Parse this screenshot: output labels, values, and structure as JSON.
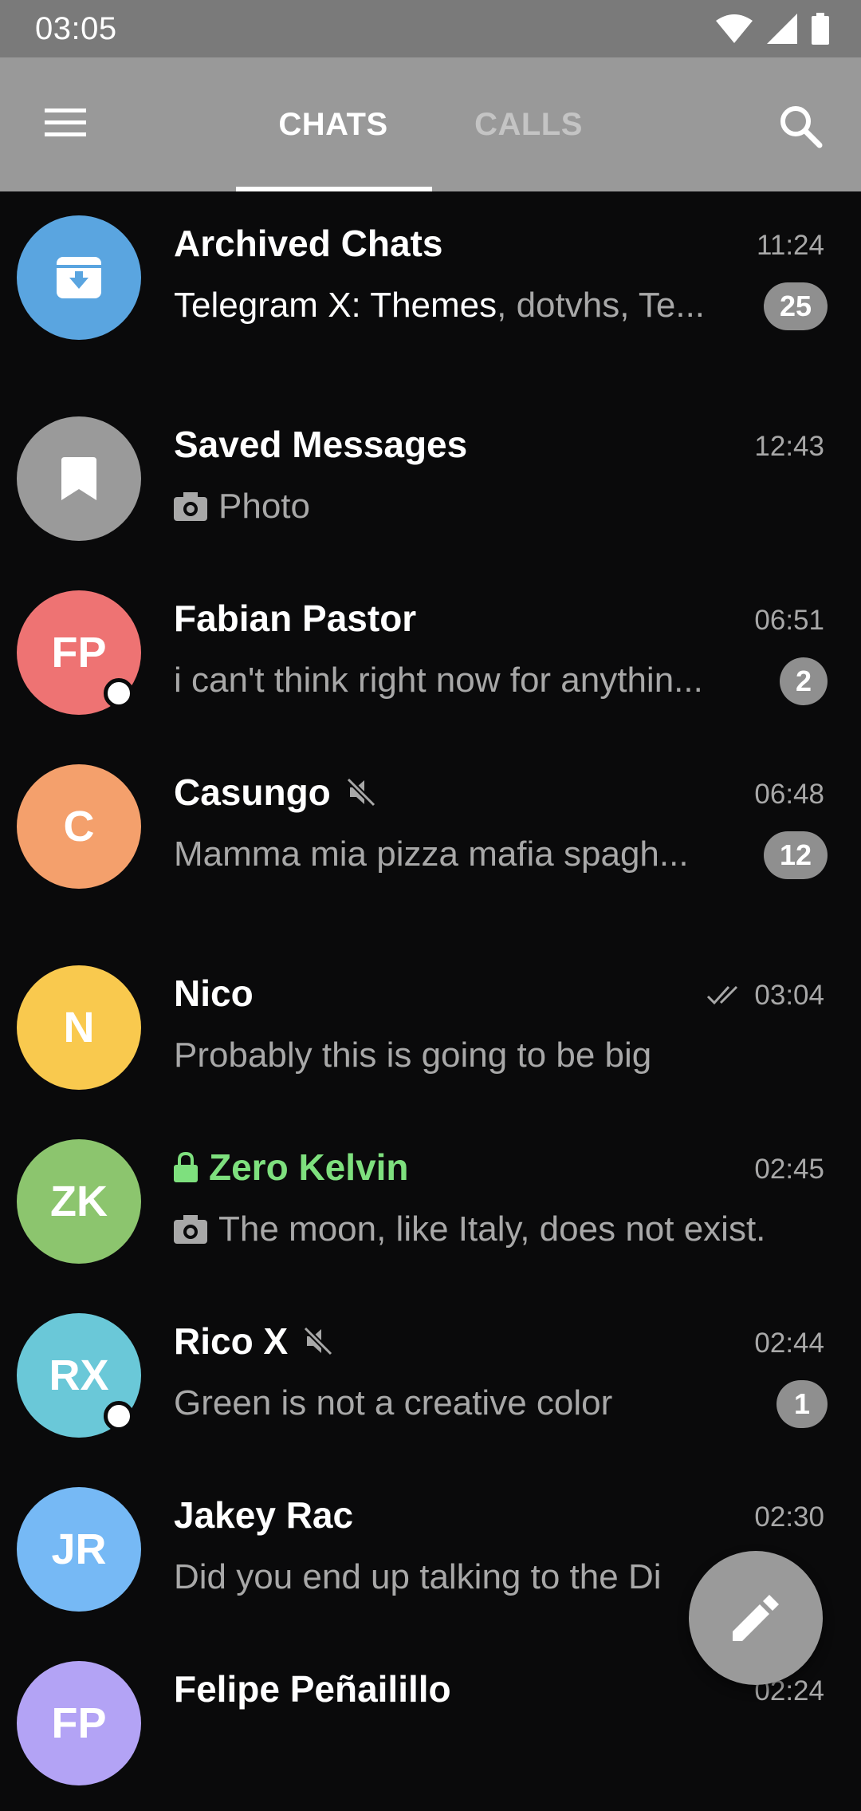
{
  "status_bar": {
    "time": "03:05"
  },
  "header": {
    "tabs": [
      {
        "label": "CHATS",
        "active": true
      },
      {
        "label": "CALLS",
        "active": false
      }
    ]
  },
  "colors": {
    "appbar": "#999999",
    "background": "#0a0a0b",
    "secret_chat": "#7ee07e",
    "badge": "#8f8f8f"
  },
  "chats": [
    {
      "name": "Archived Chats",
      "time": "11:24",
      "preview_bold": "Telegram X: Themes",
      "preview": ", dotvhs, Te...",
      "badge": "25",
      "avatar_icon": "archive-icon",
      "avatar_color": "#5aa5e0"
    },
    {
      "name": "Saved Messages",
      "time": "12:43",
      "preview": "Photo",
      "avatar_icon": "bookmark-icon",
      "avatar_color": "#9a9a9a"
    },
    {
      "name": "Fabian Pastor",
      "time": "06:51",
      "preview": "i can't think right now for anythin...",
      "badge": "2",
      "initials": "FP",
      "avatar_color": "#ee7373",
      "online": true
    },
    {
      "name": "Casungo",
      "time": "06:48",
      "preview": "Mamma mia pizza mafia spagh...",
      "badge": "12",
      "initials": "C",
      "avatar_color": "#f4a06c",
      "muted": true
    },
    {
      "name": "Nico",
      "time": "03:04",
      "preview": "Probably this is going to be big",
      "initials": "N",
      "avatar_color": "#f9c94e",
      "read": true
    },
    {
      "name": "Zero Kelvin",
      "time": "02:45",
      "preview": "The moon, like Italy, does not exist.",
      "initials": "ZK",
      "avatar_color": "#8cc56e",
      "secret": true
    },
    {
      "name": "Rico X",
      "time": "02:44",
      "preview": "Green is not a creative color",
      "badge": "1",
      "initials": "RX",
      "avatar_color": "#6ac8d8",
      "muted": true,
      "online": true
    },
    {
      "name": "Jakey Rac",
      "time": "02:30",
      "preview": "Did you end up talking to the Di",
      "initials": "JR",
      "avatar_color": "#76b9f5"
    },
    {
      "name": "Felipe Peñailillo",
      "time": "02:24",
      "initials": "FP",
      "avatar_color": "#b3a3f5"
    }
  ]
}
